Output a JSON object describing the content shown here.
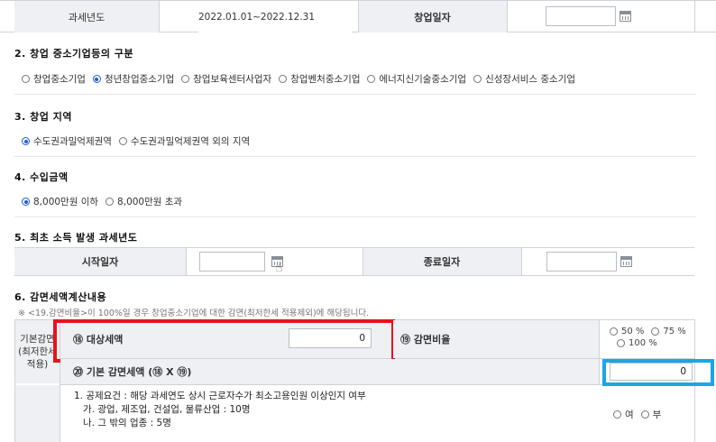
{
  "top_row": {
    "label_tax_year": "과세년도",
    "tax_year_value": "2022.01.01~2022.12.31",
    "label_start_date": "창업일자"
  },
  "section2": {
    "title": "2. 창업 중소기업등의 구분",
    "options": [
      "창업중소기업",
      "청년창업중소기업",
      "창업보육센터사업자",
      "창업벤처중소기업",
      "에너지신기술중소기업",
      "신성장서비스 중소기업"
    ],
    "selected": "청년창업중소기업"
  },
  "section3": {
    "title": "3. 창업 지역",
    "options": [
      "수도권과밀억제권역",
      "수도권과밀억제권역 외의 지역"
    ],
    "selected": "수도권과밀억제권역"
  },
  "section4": {
    "title": "4. 수입금액",
    "options": [
      "8,000만원 이하",
      "8,000만원 초과"
    ],
    "selected": "8,000만원 이하"
  },
  "section5": {
    "title": "5. 최초 소득 발생 과세년도",
    "label_start": "시작일자",
    "label_end": "종료일자"
  },
  "section6": {
    "title": "6. 감면세액계산내용",
    "notice": "※ <19.감면비율>이 100%일 경우 창업중소기업에 대한 감면(최저한세 적용제외)에 해당됩니다.",
    "basic_label": "기본감면(최저한세적용)",
    "target_tax_label": "⑱ 대상세액",
    "target_tax_value": "0",
    "rate_label": "⑲ 감면비율",
    "rate_options": [
      "50 %",
      "75 %",
      "100 %"
    ],
    "basic_tax_label": "⑳ 기본 감면세액 (⑱ X ⑲)",
    "basic_tax_value": "0",
    "req_line1": "1. 공제요건 : 해당 과세연도 상시 근로자수가 최소고용인원 이상인지 여부",
    "req_line2": "가. 광업, 제조업, 건설업, 물류산업 : 10명",
    "req_line3": "나. 그 밖의 업종 : 5명",
    "yes_label": "여",
    "no_label": "부"
  },
  "colors": {
    "highlight_red": "#e8121c",
    "highlight_blue": "#1aa6e6",
    "radio_selected": "#1b5fd1"
  }
}
